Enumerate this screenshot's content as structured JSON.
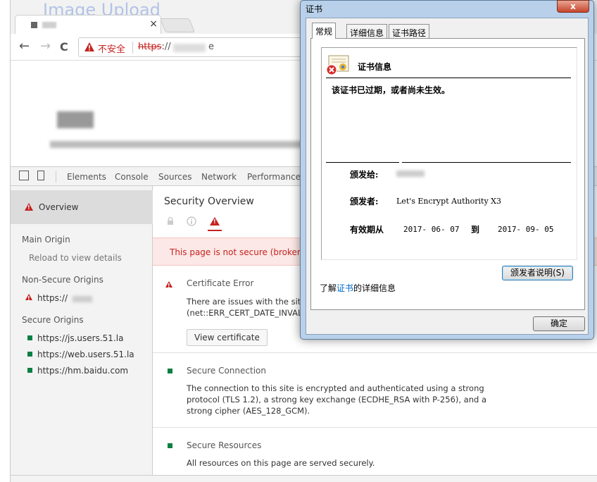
{
  "browser": {
    "ghost_text": "Image Upload",
    "tab_close": "×",
    "nav": {
      "back": "←",
      "forward": "→",
      "reload": "C"
    },
    "omnibox": {
      "security_label": "不安全",
      "scheme": "https",
      "url_rest": "://",
      "url_end": "e"
    }
  },
  "devtools": {
    "tabs": [
      "Elements",
      "Console",
      "Sources",
      "Network",
      "Performance"
    ],
    "sidebar": {
      "overview": "Overview",
      "main_origin_heading": "Main Origin",
      "main_origin_item": "Reload to view details",
      "non_secure_heading": "Non-Secure Origins",
      "non_secure_item": "https://",
      "secure_heading": "Secure Origins",
      "secure_items": [
        "https://js.users.51.la",
        "https://web.users.51.la",
        "https://hm.baidu.com"
      ]
    },
    "main": {
      "title": "Security Overview",
      "banner": "This page is not secure (broken HT",
      "cert_error_title": "Certificate Error",
      "cert_error_line1": "There are issues with the site's",
      "cert_error_line2": "(net::ERR_CERT_DATE_INVALID",
      "view_cert": "View certificate",
      "secure_conn_title": "Secure Connection",
      "secure_conn_lines": [
        "The connection to this site is encrypted and authenticated using a strong",
        "protocol (TLS 1.2), a strong key exchange (ECDHE_RSA with P-256), and a",
        "strong cipher (AES_128_GCM)."
      ],
      "secure_res_title": "Secure Resources",
      "secure_res_line": "All resources on this page are served securely."
    }
  },
  "dialog": {
    "title": "证书",
    "close": "x",
    "tabs": [
      "常规",
      "详细信息",
      "证书路径"
    ],
    "info_heading": "证书信息",
    "status_text": "该证书已过期，或者尚未生效。",
    "issued_to_label": "颁发给:",
    "issued_by_label": "颁发者:",
    "issued_by_value": "Let's Encrypt Authority X3",
    "validity_label": "有效期从",
    "valid_from": "2017- 06- 07",
    "to_label": "到",
    "valid_to": "2017- 09- 05",
    "issuer_statement": "颁发者说明(S)",
    "learn_prefix": "了解",
    "learn_link": "证书",
    "learn_suffix": "的详细信息",
    "ok": "确定"
  },
  "colors": {
    "danger": "#c5221f",
    "secure": "#0b8043",
    "link": "#0066cc"
  }
}
